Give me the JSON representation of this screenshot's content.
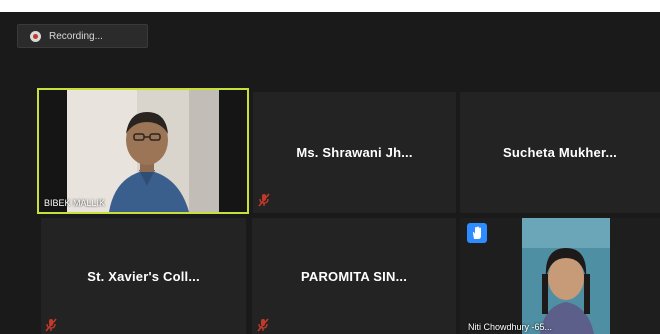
{
  "recording": {
    "label": "Recording..."
  },
  "tiles": [
    {
      "name": "BIBEK MALLIK"
    },
    {
      "name": "Ms. Shrawani Jh..."
    },
    {
      "name": "Sucheta Mukher..."
    },
    {
      "name": "St. Xavier's Coll..."
    },
    {
      "name": "PAROMITA SIN..."
    },
    {
      "name": "Niti Chowdhury -65..."
    }
  ],
  "colors": {
    "active_speaker_border": "#c8e03a",
    "muted_icon": "#c0392b",
    "raise_hand": "#2d8cff"
  }
}
